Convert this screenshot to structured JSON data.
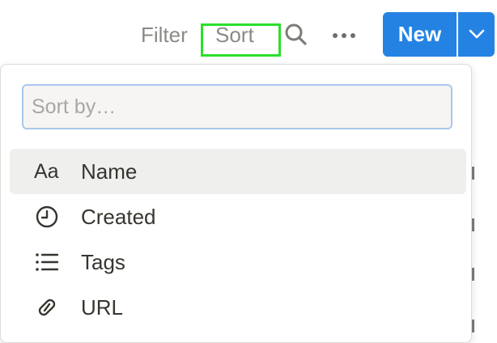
{
  "toolbar": {
    "filter_label": "Filter",
    "sort_label": "Sort",
    "search_icon": "search-icon",
    "more_icon": "more-horizontal-icon",
    "new_label": "New",
    "new_caret_icon": "chevron-down-icon",
    "accent_color": "#2483e2",
    "highlight_color": "#2bdf2b"
  },
  "sort_menu": {
    "search_placeholder": "Sort by…",
    "search_value": "",
    "items": [
      {
        "label": "Name",
        "icon": "text-type-icon",
        "icon_text": "Aa",
        "active": true
      },
      {
        "label": "Created",
        "icon": "clock-icon",
        "active": false
      },
      {
        "label": "Tags",
        "icon": "list-icon",
        "active": false
      },
      {
        "label": "URL",
        "icon": "link-icon",
        "active": false
      }
    ]
  }
}
